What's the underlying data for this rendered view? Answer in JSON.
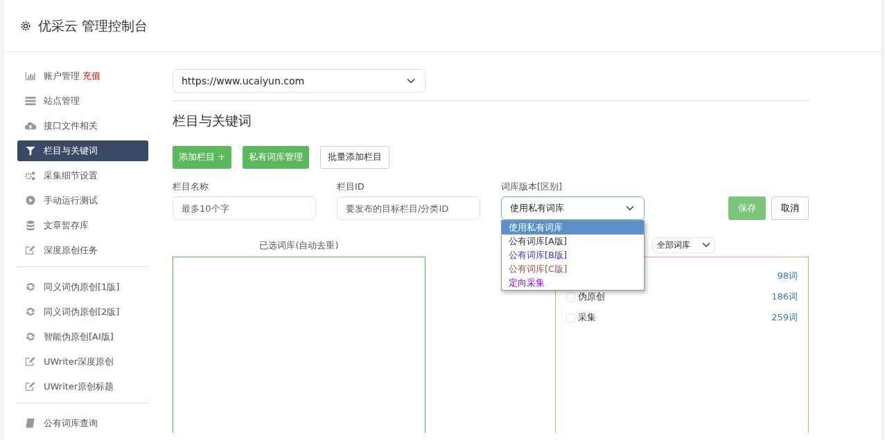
{
  "header": {
    "title": "优采云 管理控制台"
  },
  "sidebar": {
    "groups": [
      [
        {
          "label": "账户管理",
          "extra": "充值",
          "selected": false
        },
        {
          "label": "站点管理",
          "selected": false
        },
        {
          "label": "接口文件相关",
          "selected": false
        },
        {
          "label": "栏目与关键词",
          "selected": true
        },
        {
          "label": "采集细节设置",
          "selected": false
        },
        {
          "label": "手动运行测试",
          "selected": false
        },
        {
          "label": "文章暂存库",
          "selected": false
        },
        {
          "label": "深度原创任务",
          "selected": false
        }
      ],
      [
        {
          "label": "同义词伪原创[1版]",
          "selected": false
        },
        {
          "label": "同义词伪原创[2版]",
          "selected": false
        },
        {
          "label": "智能伪原创[AI版]",
          "selected": false
        },
        {
          "label": "UWriter深度原创",
          "selected": false
        },
        {
          "label": "UWriter原创标题",
          "selected": false
        }
      ],
      [
        {
          "label": "公有词库查询",
          "selected": false
        }
      ]
    ]
  },
  "site_select": {
    "value": "https://www.ucaiyun.com"
  },
  "section_title": "栏目与关键词",
  "actions": [
    {
      "label": "添加栏目 +",
      "kind": "green"
    },
    {
      "label": "私有词库管理",
      "kind": "green"
    },
    {
      "label": "批量添加栏目",
      "kind": "plain"
    }
  ],
  "form": {
    "fields": [
      {
        "label": "栏目名称",
        "placeholder": "最多10个字"
      },
      {
        "label": "栏目ID",
        "placeholder": "要发布的目标栏目/分类ID"
      }
    ],
    "library_label": "词库版本[区别]",
    "library_value": "使用私有词库",
    "library_options": [
      {
        "label": "使用私有词库",
        "selected": true
      },
      {
        "label": "公有词库[A版]",
        "selected": false,
        "color": "#333333"
      },
      {
        "label": "公有词库[B版]",
        "selected": false,
        "color": "#3333ff"
      },
      {
        "label": "公有词库[C版]",
        "selected": false,
        "color": "#a05050"
      },
      {
        "label": "定向采集",
        "selected": false,
        "color": "#8800ff"
      }
    ],
    "save": "保存",
    "cancel": "取消"
  },
  "selected_label": "已选词库(自动去重)",
  "filter_select": {
    "value": "全部词库"
  },
  "library_list": [
    {
      "count": "98词"
    },
    {
      "label": "伪原创",
      "count": "186词",
      "checked": false
    },
    {
      "label": "采集",
      "count": "259词",
      "checked": false
    }
  ]
}
